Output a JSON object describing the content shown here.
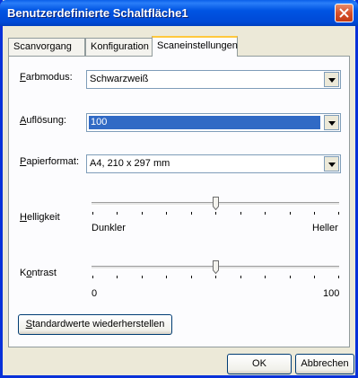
{
  "window": {
    "title": "Benutzerdefinierte Schaltfläche1"
  },
  "tabs": [
    {
      "label": "Scanvorgang",
      "active": false
    },
    {
      "label": "Konfiguration",
      "active": false
    },
    {
      "label": "Scaneinstellungen",
      "active": true
    }
  ],
  "settings": {
    "color_mode": {
      "label_mnemonic": "F",
      "label_rest": "arbmodus:",
      "value": "Schwarzweiß"
    },
    "resolution": {
      "label_mnemonic": "A",
      "label_rest": "uflösung:",
      "value": "100"
    },
    "paper_format": {
      "label_mnemonic": "P",
      "label_rest": "apierformat:",
      "value": "A4, 210 x 297 mm"
    }
  },
  "brightness": {
    "label_mnemonic": "H",
    "label_rest": "elligkeit",
    "min_label": "Dunkler",
    "max_label": "Heller",
    "level": 0.5
  },
  "contrast": {
    "label_pre": "K",
    "label_mnemonic": "o",
    "label_rest": "ntrast",
    "min_label": "0",
    "max_label": "100",
    "level": 0.5
  },
  "buttons": {
    "restore_defaults_mnemonic": "S",
    "restore_defaults_rest": "tandardwerte wiederherstellen",
    "ok": "OK",
    "cancel": "Abbrechen"
  }
}
